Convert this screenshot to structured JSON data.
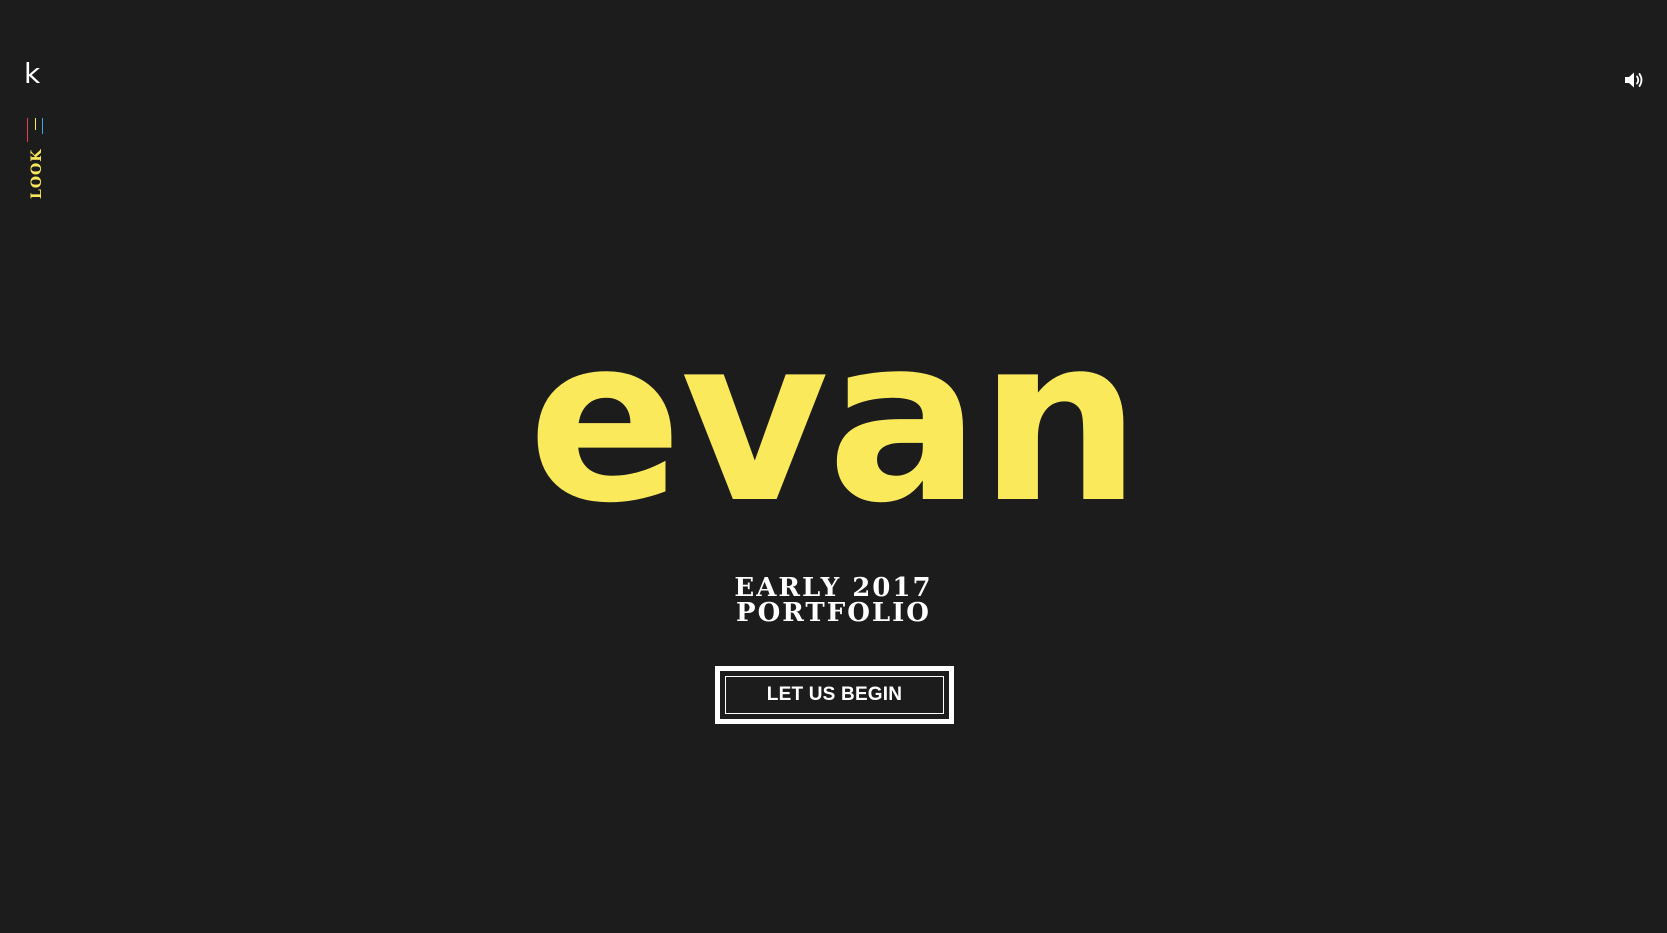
{
  "header": {
    "logo_text": "k",
    "nav_label": "LOOK",
    "nav_icon": "color-bars-icon",
    "sound_icon": "speaker-volume-icon"
  },
  "hero": {
    "name": "evan",
    "subtitle_line1": "EARLY 2017",
    "subtitle_line2": "PORTFOLIO",
    "cta_label": "LET US BEGIN"
  },
  "colors": {
    "background": "#1c1c1c",
    "accent_yellow": "#fbe95c",
    "text_white": "#ffffff",
    "bar_red": "#e0434f",
    "bar_yellow": "#fbe95c",
    "bar_blue": "#3aa9e0"
  }
}
